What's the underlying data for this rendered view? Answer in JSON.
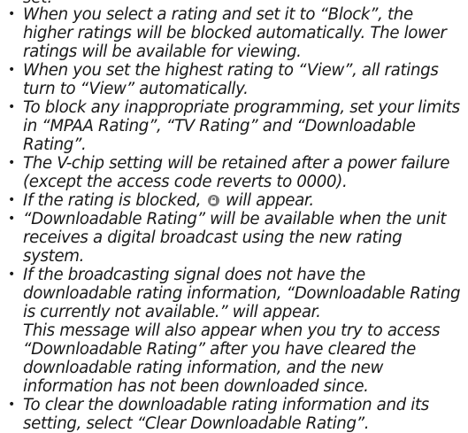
{
  "partial_top_line": "set.",
  "notes": [
    {
      "text": "When you select a rating and set it to “Block”, the higher ratings will be blocked automatically. The lower ratings will be available for viewing."
    },
    {
      "text": "When you set the highest rating to “View”, all ratings turn to “View” automatically."
    },
    {
      "text": "To block any inappropriate programming, set your limits in “MPAA Rating”, “TV Rating” and “Downloadable Rating”."
    },
    {
      "text": "The V-chip setting will be retained after a power failure (except the access code reverts to 0000)."
    },
    {
      "text_before_icon": "If the rating is blocked,",
      "icon": "lock-icon",
      "text_after_icon": "will appear."
    },
    {
      "text": "“Downloadable Rating” will be available when the unit receives a digital broadcast using the new rating system."
    },
    {
      "text": "If the broadcasting signal does not have the downloadable rating information, “Downloadable Rating is currently not available.” will appear.",
      "continuation": "This message will also appear when you try to access “Downloadable Rating” after you have cleared the downloadable rating information, and the new information has not been downloaded since."
    },
    {
      "text": "To clear the downloadable rating information and its setting, select “Clear Downloadable Rating”."
    }
  ],
  "bullet_glyph": "•"
}
